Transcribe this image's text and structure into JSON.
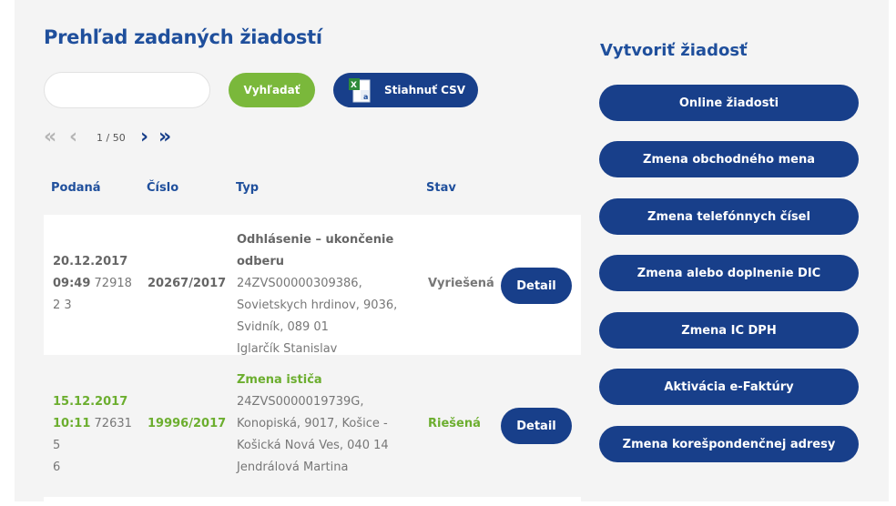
{
  "page": {
    "title": "Prehľad zadaných žiadostí",
    "search_button": "Vyhľadať",
    "csv_button": "Stiahnuť CSV",
    "search_value": ""
  },
  "pagination": {
    "first": "«",
    "prev": "‹",
    "info": "1 / 50",
    "next": "›",
    "last": "»"
  },
  "table": {
    "headers": [
      "Podaná",
      "Číslo",
      "Typ",
      "Stav"
    ],
    "rows": [
      {
        "date": "20.12.2017",
        "time": "09:49",
        "id_line1": "72918",
        "id_line2": "2 3",
        "number": "20267/2017",
        "type": "Odhlásenie – ukončenie odberu",
        "code": "24ZVS00000309386,",
        "address1": "Sovietskych hrdinov, 9036,",
        "address2": "Svidník, 089 01",
        "person": "Iglarčík Stanislav",
        "status": "Vyriešená",
        "detail": "Detail"
      },
      {
        "date": "15.12.2017",
        "time": "10:11",
        "id_line1": "72631 5",
        "id_line2": "6",
        "number": "19996/2017",
        "type": "Zmena ističa",
        "code": "24ZVS0000019739G,",
        "address1": "Konopiská, 9017, Košice -",
        "address2": "Košická Nová Ves, 040 14",
        "person": "Jendrálová Martina",
        "status": "Riešená",
        "detail": "Detail"
      }
    ]
  },
  "sidebar": {
    "title": "Vytvoriť žiadosť",
    "buttons": [
      "Online žiadosti",
      "Zmena obchodného mena",
      "Zmena telefónnych čísel",
      "Zmena alebo doplnenie DIC",
      "Zmena IC DPH",
      "Aktivácia e-Faktúry",
      "Zmena korešpondenčnej adresy"
    ]
  },
  "colors": {
    "brand_blue": "#183f8a",
    "title_blue": "#1f4f9c",
    "green": "#7ab83b",
    "panel_bg": "#f4f4f4"
  },
  "icons": [
    "excel-csv-icon",
    "double-chevron-left-icon",
    "chevron-left-icon",
    "chevron-right-icon",
    "double-chevron-right-icon"
  ]
}
